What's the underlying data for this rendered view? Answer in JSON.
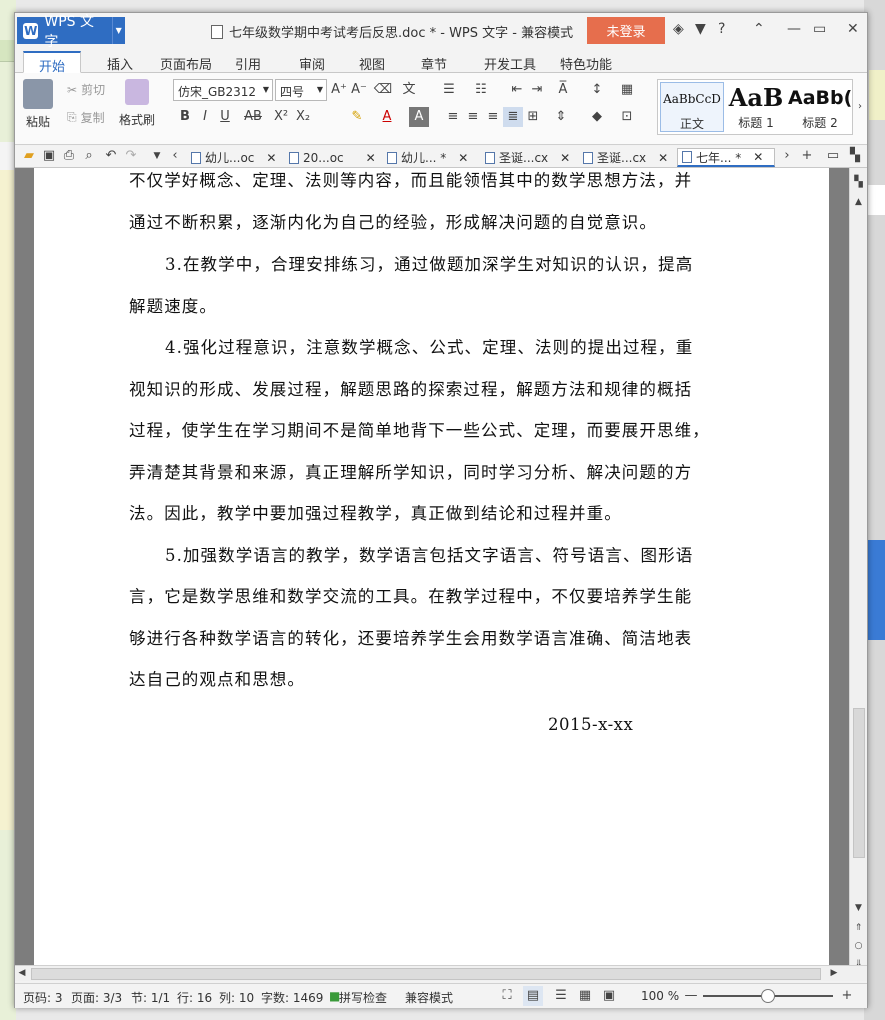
{
  "app": {
    "name": "WPS 文字",
    "title": "七年级数学期中考试考后反思.doc * - WPS 文字 - 兼容模式",
    "login": "未登录"
  },
  "menu_tabs": [
    "开始",
    "插入",
    "页面布局",
    "引用",
    "审阅",
    "视图",
    "章节",
    "开发工具",
    "特色功能"
  ],
  "ribbon": {
    "paste": "粘贴",
    "cut": "剪切",
    "copy": "复制",
    "format_painter": "格式刷",
    "font_name": "仿宋_GB2312",
    "font_size": "四号",
    "styles": [
      {
        "preview": "AaBbCcD",
        "label": "正文"
      },
      {
        "preview": "AaB",
        "label": "标题 1"
      },
      {
        "preview": "AaBb(",
        "label": "标题 2"
      }
    ]
  },
  "doc_tabs": [
    "幼儿...oc",
    "20...oc",
    "幼儿... *",
    "圣诞...cx",
    "圣诞...cx",
    "七年... *"
  ],
  "document": {
    "paragraphs": [
      "不仅学好概念、定理、法则等内容，而且能领悟其中的数学思想方法，并",
      "通过不断积累，逐渐内化为自己的经验，形成解决问题的自觉意识。",
      "3.在教学中，合理安排练习，通过做题加深学生对知识的认识，提高",
      "解题速度。",
      "4.强化过程意识，注意数学概念、公式、定理、法则的提出过程，重",
      "视知识的形成、发展过程，解题思路的探索过程，解题方法和规律的概括",
      "过程，使学生在学习期间不是简单地背下一些公式、定理，而要展开思维，",
      "弄清楚其背景和来源，真正理解所学知识，同时学习分析、解决问题的方",
      "法。因此，教学中要加强过程教学，真正做到结论和过程并重。",
      "5.加强数学语言的教学，数学语言包括文字语言、符号语言、图形语",
      "言，它是数学思维和数学交流的工具。在教学过程中，不仅要培养学生能",
      "够进行各种数学语言的转化，还要培养学生会用数学语言准确、简洁地表",
      "达自己的观点和思想。"
    ],
    "date": "2015-x-xx"
  },
  "status": {
    "page_code": "页码: 3",
    "pages": "页面: 3/3",
    "section": "节: 1/1",
    "row": "行: 16",
    "col": "列: 10",
    "words": "字数: 1469",
    "spell": "拼写检查",
    "mode": "兼容模式",
    "zoom": "100 %",
    "zoom_level": 0.5
  }
}
